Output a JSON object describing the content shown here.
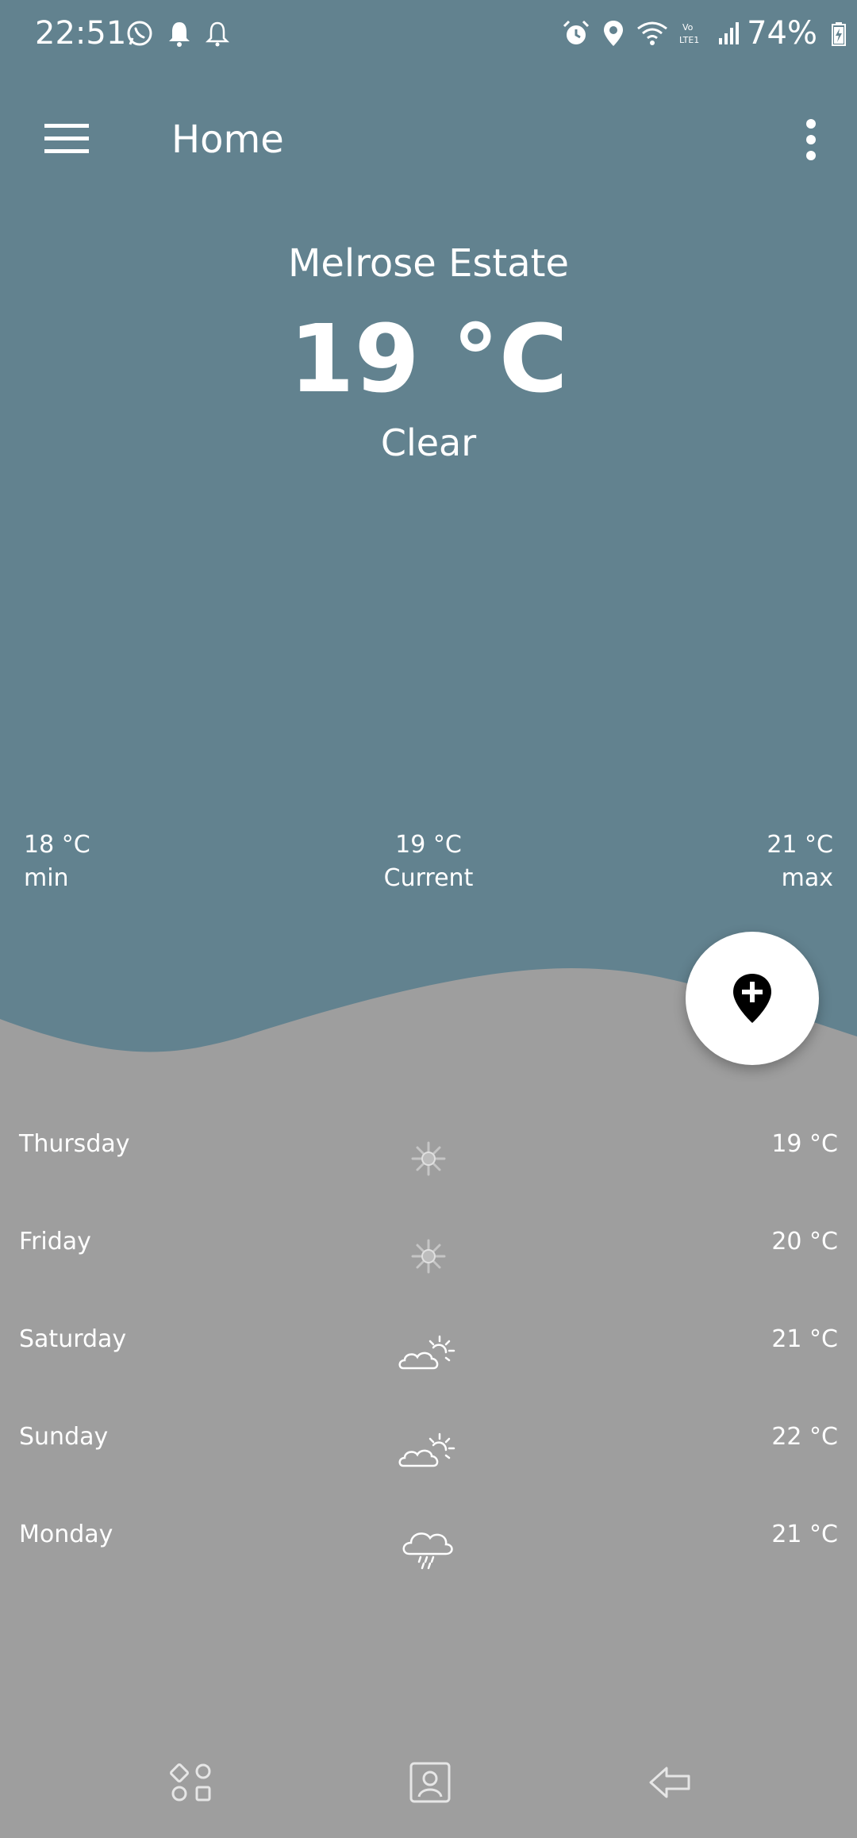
{
  "status_bar": {
    "time": "22:51",
    "battery": "74%",
    "left_icons": [
      "whatsapp-icon",
      "bell-icon",
      "bell-outline-icon"
    ],
    "right_icons": [
      "alarm-icon",
      "location-icon",
      "wifi-icon",
      "volte-icon",
      "signal-icon",
      "battery-icon"
    ]
  },
  "app_bar": {
    "title": "Home"
  },
  "current": {
    "location": "Melrose Estate",
    "temperature": "19 °C",
    "condition": "Clear"
  },
  "stats": {
    "min_value": "18 °C",
    "min_label": "min",
    "current_value": "19 °C",
    "current_label": "Current",
    "max_value": "21 °C",
    "max_label": "max"
  },
  "forecast": [
    {
      "day": "Thursday",
      "icon": "sun-icon",
      "temp": "19 °C"
    },
    {
      "day": "Friday",
      "icon": "sun-icon",
      "temp": "20 °C"
    },
    {
      "day": "Saturday",
      "icon": "partly-cloudy-icon",
      "temp": "21 °C"
    },
    {
      "day": "Sunday",
      "icon": "partly-cloudy-icon",
      "temp": "22 °C"
    },
    {
      "day": "Monday",
      "icon": "rain-cloud-icon",
      "temp": "21 °C"
    }
  ],
  "fab": {
    "icon": "add-location-icon"
  },
  "nav_bar": {
    "icons": [
      "recent-apps-icon",
      "home-icon",
      "back-icon"
    ]
  },
  "colors": {
    "top_panel": "#62828f",
    "bottom_panel": "#9e9e9e",
    "text": "#ffffff",
    "fab_background": "#ffffff"
  }
}
